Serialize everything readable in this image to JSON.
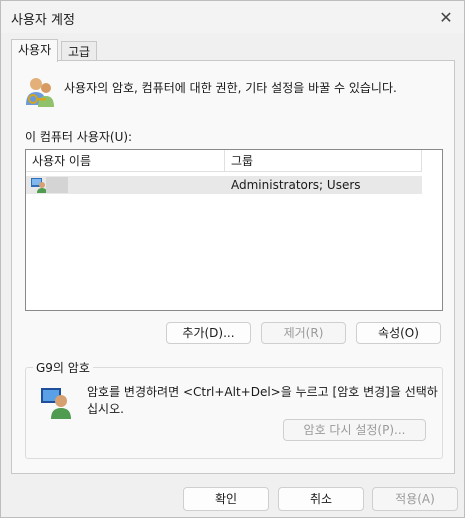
{
  "window": {
    "title": "사용자 계정",
    "close_glyph": "✕"
  },
  "tabs": [
    {
      "label": "사용자",
      "active": true
    },
    {
      "label": "고급",
      "active": false
    }
  ],
  "users_tab": {
    "description": "사용자의 암호, 컴퓨터에 대한 권한, 기타 설정을 바꿀 수 있습니다.",
    "users_label": "이 컴퓨터 사용자(U):",
    "columns": [
      "사용자 이름",
      "그룹"
    ],
    "rows": [
      {
        "name": "",
        "group": "Administrators; Users",
        "icon": "user-icon"
      }
    ],
    "buttons": {
      "add": "추가(D)...",
      "remove": "제거(R)",
      "properties": "속성(O)"
    },
    "password_group": {
      "title": "G9의 암호",
      "text": "암호를 변경하려면 <Ctrl+Alt+Del>을 누르고 [암호 변경]을 선택하십시오.",
      "reset_button": "암호 다시 설정(P)..."
    }
  },
  "footer": {
    "ok": "확인",
    "cancel": "취소",
    "apply": "적용(A)"
  }
}
